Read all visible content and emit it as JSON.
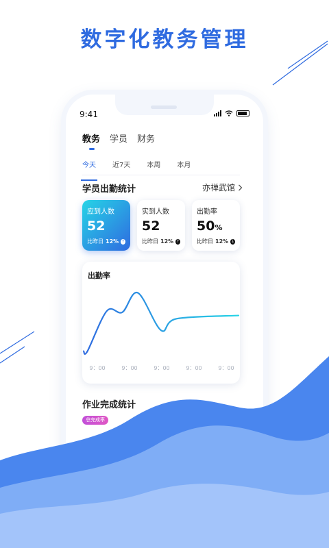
{
  "headline": "数字化教务管理",
  "status": {
    "time": "9:41"
  },
  "main_tabs": [
    {
      "label": "教务",
      "active": true
    },
    {
      "label": "学员",
      "active": false
    },
    {
      "label": "财务",
      "active": false
    }
  ],
  "sub_tabs": [
    {
      "label": "今天",
      "active": true
    },
    {
      "label": "近7天",
      "active": false
    },
    {
      "label": "本周",
      "active": false
    },
    {
      "label": "本月",
      "active": false
    }
  ],
  "attendance": {
    "title": "学员出勤统计",
    "venue": "亦禅武馆",
    "cards": [
      {
        "label": "应到人数",
        "value": "52",
        "unit": "",
        "compare_label": "比昨日",
        "compare_value": "12%"
      },
      {
        "label": "实到人数",
        "value": "52",
        "unit": "",
        "compare_label": "比昨日",
        "compare_value": "12%"
      },
      {
        "label": "出勤率",
        "value": "50",
        "unit": "%",
        "compare_label": "比昨日",
        "compare_value": "12%"
      }
    ]
  },
  "chart_data": {
    "type": "line",
    "title": "出勤率",
    "categories": [
      "9：00",
      "9：00",
      "9：00",
      "9：00",
      "9：00"
    ],
    "series": [
      {
        "values": [
          10,
          10,
          72,
          70,
          100,
          42,
          60,
          65
        ]
      }
    ],
    "x": [
      0,
      0.1,
      0.6,
      1.0,
      1.4,
      2.0,
      2.4,
      4.0
    ],
    "ylim": [
      0,
      110
    ],
    "grid": false
  },
  "homework": {
    "title": "作业完成统计",
    "badge": "总完成率"
  },
  "colors": {
    "accent": "#2f6be0",
    "gradient_start": "#26d4e6",
    "wave_dark": "#4a86ee",
    "wave_light": "#7fadf6"
  }
}
